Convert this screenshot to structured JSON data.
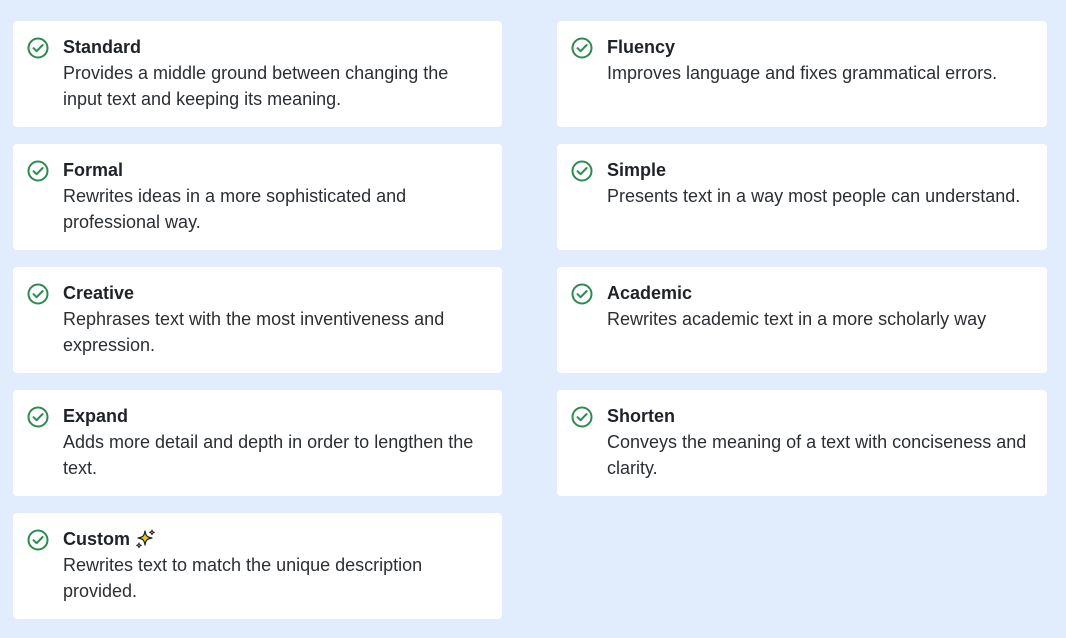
{
  "options": [
    {
      "title": "Standard",
      "description": "Provides a middle ground between changing the input text and keeping its meaning."
    },
    {
      "title": "Fluency",
      "description": "Improves language and fixes grammatical errors."
    },
    {
      "title": "Formal",
      "description": "Rewrites ideas in a more sophisticated and professional way."
    },
    {
      "title": "Simple",
      "description": "Presents text in a way most people can understand."
    },
    {
      "title": "Creative",
      "description": "Rephrases text with the most inventiveness and expression."
    },
    {
      "title": "Academic",
      "description": "Rewrites academic text in a more scholarly way"
    },
    {
      "title": "Expand",
      "description": "Adds more detail and depth in order to lengthen the text."
    },
    {
      "title": "Shorten",
      "description": "Conveys the meaning of a text with conciseness and clarity."
    },
    {
      "title": "Custom",
      "description": "Rewrites text to match the unique description provided.",
      "icon": "sparkles-icon"
    }
  ],
  "colors": {
    "background": "#e1edfc",
    "card": "#ffffff",
    "check": "#2e8b4e",
    "sparkle": "#f5c518"
  }
}
